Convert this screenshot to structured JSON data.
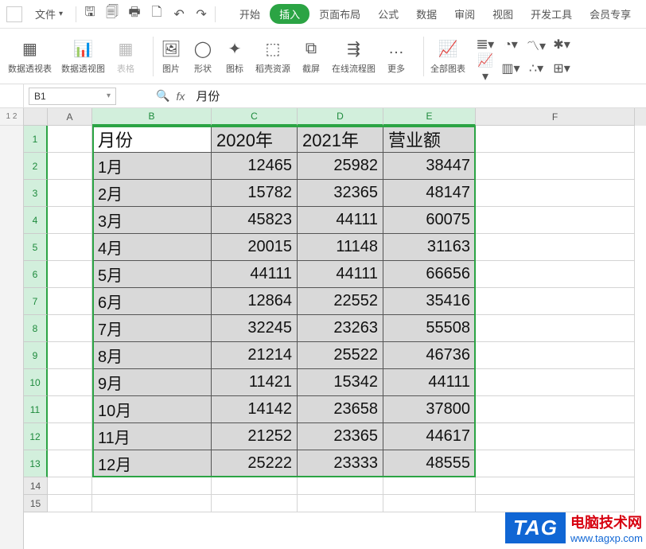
{
  "titlebar": {
    "file_label": "文件"
  },
  "menu": {
    "tabs": [
      "开始",
      "插入",
      "页面布局",
      "公式",
      "数据",
      "审阅",
      "视图",
      "开发工具",
      "会员专享"
    ],
    "active_index": 1
  },
  "ribbon": {
    "groups": [
      "数据透视表",
      "数据透视图",
      "表格",
      "图片",
      "形状",
      "图标",
      "稻壳资源",
      "截屏",
      "在线流程图",
      "更多",
      "全部图表"
    ]
  },
  "namebox": {
    "value": "B1"
  },
  "formula": {
    "fx_label": "fx",
    "value": "月份"
  },
  "columns": [
    "A",
    "B",
    "C",
    "D",
    "E",
    "F"
  ],
  "table": {
    "headers": [
      "月份",
      "2020年",
      "2021年",
      "营业额"
    ],
    "rows": [
      {
        "m": "1月",
        "y20": 12465,
        "y21": 25982,
        "sum": 38447
      },
      {
        "m": "2月",
        "y20": 15782,
        "y21": 32365,
        "sum": 48147
      },
      {
        "m": "3月",
        "y20": 45823,
        "y21": 44111,
        "sum": 60075
      },
      {
        "m": "4月",
        "y20": 20015,
        "y21": 11148,
        "sum": 31163
      },
      {
        "m": "5月",
        "y20": 44111,
        "y21": 44111,
        "sum": 66656
      },
      {
        "m": "6月",
        "y20": 12864,
        "y21": 22552,
        "sum": 35416
      },
      {
        "m": "7月",
        "y20": 32245,
        "y21": 23263,
        "sum": 55508
      },
      {
        "m": "8月",
        "y20": 21214,
        "y21": 25522,
        "sum": 46736
      },
      {
        "m": "9月",
        "y20": 11421,
        "y21": 15342,
        "sum": 44111
      },
      {
        "m": "10月",
        "y20": 14142,
        "y21": 23658,
        "sum": 37800
      },
      {
        "m": "11月",
        "y20": 21252,
        "y21": 23365,
        "sum": 44617
      },
      {
        "m": "12月",
        "y20": 25222,
        "y21": 23333,
        "sum": 48555
      }
    ]
  },
  "row_numbers": [
    1,
    2,
    3,
    4,
    5,
    6,
    7,
    8,
    9,
    10,
    11,
    12,
    13,
    14,
    15
  ],
  "gutter": {
    "g1": "1",
    "g2": "2"
  },
  "watermark": {
    "tag": "TAG",
    "line1": "电脑技术网",
    "line2": "www.tagxp.com"
  }
}
